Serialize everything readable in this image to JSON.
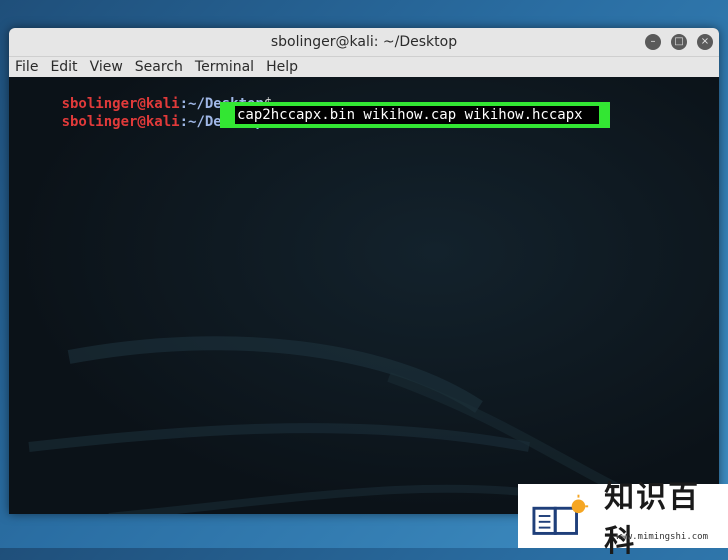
{
  "window": {
    "title": "sbolinger@kali: ~/Desktop",
    "buttons": {
      "minimize": "–",
      "maximize": "□",
      "close": "×"
    }
  },
  "menubar": {
    "items": [
      "File",
      "Edit",
      "View",
      "Search",
      "Terminal",
      "Help"
    ]
  },
  "terminal": {
    "lines": [
      {
        "user": "sbolinger@kali",
        "path": ":~/Desktop",
        "suffix": "$"
      },
      {
        "user": "sbolinger@kali",
        "path": ":~/Desktop",
        "suffix": "$"
      }
    ],
    "highlighted_command": "cap2hccapx.bin wikihow.cap wikihow.hccapx",
    "highlight_color": "#33e633"
  },
  "watermark": {
    "text": "知识百科",
    "url": "www.mimingshi.com"
  }
}
